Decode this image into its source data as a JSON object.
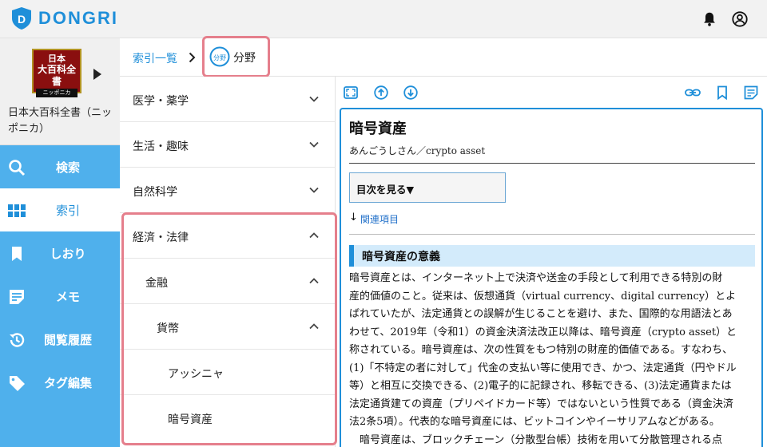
{
  "header": {
    "logo_text": "DONGRI",
    "logo_badge_letter": "D",
    "icons": {
      "notifications": "bell-icon",
      "account": "account-icon"
    }
  },
  "book": {
    "cover_line1": "日本",
    "cover_line2": "大百科全書",
    "cover_line3": "ニッポニカ",
    "title": "日本大百科全書（ニッポニカ）"
  },
  "sidebar": {
    "items": [
      {
        "label": "検索",
        "icon": "search-icon",
        "active": false
      },
      {
        "label": "索引",
        "icon": "grid-icon",
        "active": true
      },
      {
        "label": "しおり",
        "icon": "bookmark-icon",
        "active": false
      },
      {
        "label": "メモ",
        "icon": "memo-icon",
        "active": false
      },
      {
        "label": "閲覧履歴",
        "icon": "history-icon",
        "active": false
      },
      {
        "label": "タグ編集",
        "icon": "tag-icon",
        "active": false
      }
    ]
  },
  "breadcrumb": {
    "parent": "索引一覧",
    "current": "分野",
    "current_icon_text": "分野"
  },
  "categories": [
    {
      "label": "医学・薬学",
      "level": 0,
      "expanded": false
    },
    {
      "label": "生活・趣味",
      "level": 0,
      "expanded": false
    },
    {
      "label": "自然科学",
      "level": 0,
      "expanded": false
    },
    {
      "label": "経済・法律",
      "level": 0,
      "expanded": true
    },
    {
      "label": "金融",
      "level": 1,
      "expanded": true
    },
    {
      "label": "貨幣",
      "level": 2,
      "expanded": true
    },
    {
      "label": "アッシニャ",
      "level": 3
    },
    {
      "label": "暗号資産",
      "level": 3
    }
  ],
  "article": {
    "title": "暗号資産",
    "reading": "あんごうしさん／crypto asset",
    "toc_label": "目次を見る▼",
    "related_arrow": "↓",
    "related_label": "関連項目",
    "section_heading": "暗号資産の意義",
    "paragraph_lines": [
      "暗号資産とは、インターネット上で決済や送金の手段として利用できる特別の財",
      "産的価値のこと。従来は、仮想通貨（virtual currency、digital currency）とよ",
      "ばれていたが、法定通貨との誤解が生じることを避け、また、国際的な用語法とあ",
      "わせて、2019年（令和1）の資金決済法改正以降は、暗号資産（crypto asset）と",
      "称されている。暗号資産は、次の性質をもつ特別の財産的価値である。すなわち、",
      "(1)「不特定の者に対して」代金の支払い等に使用でき、かつ、法定通貨（円やドル",
      "等）と相互に交換できる、(2)電子的に記録され、移転できる、(3)法定通貨または",
      "法定通貨建ての資産（プリペイドカード等）ではないという性質である（資金決済",
      "法2条5項）。代表的な暗号資産には、ビットコインやイーサリアムなどがある。",
      "　暗号資産は、ブロックチェーン（分散型台帳）技術を用いて分散管理される点"
    ]
  },
  "colors": {
    "brand_blue": "#1f8fd9",
    "sidebar_blue": "#4fb0ec",
    "highlight_pink": "#e57f8c",
    "section_bg": "#d3ebfb",
    "cover_red": "#8a0f0f"
  }
}
